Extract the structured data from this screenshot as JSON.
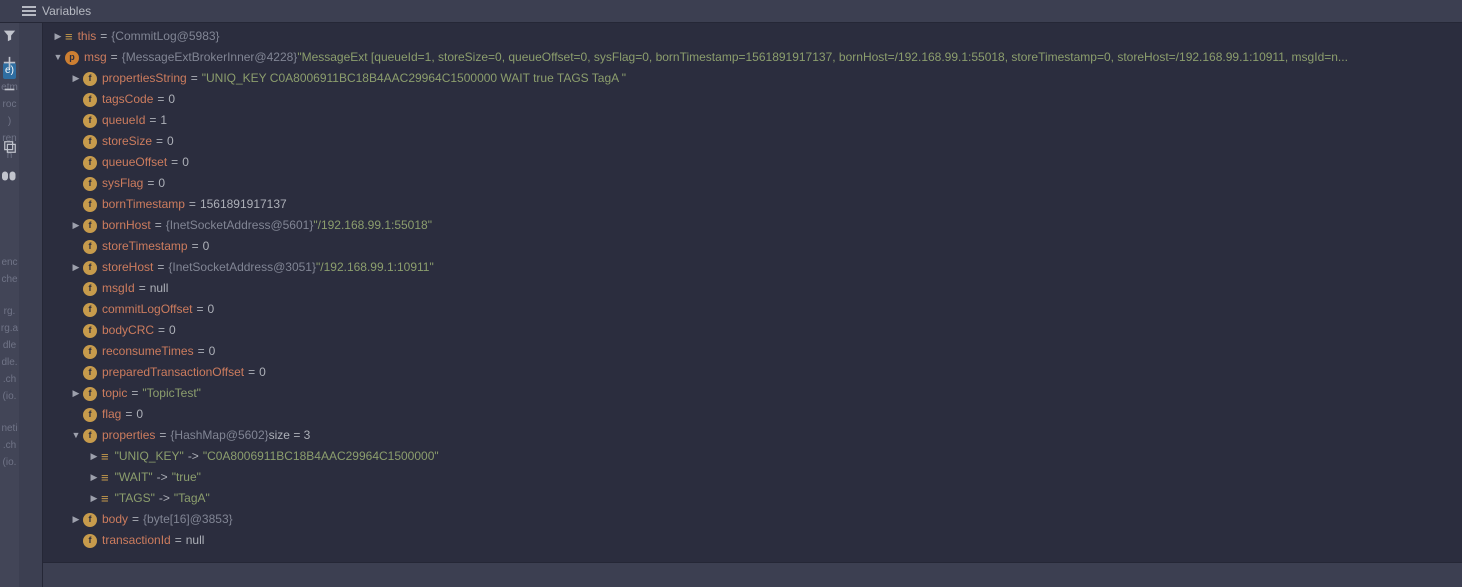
{
  "panel": {
    "title": "Variables"
  },
  "left_truncated_labels": [
    "e)",
    "etm",
    "rock",
    ")",
    "ren",
    "h",
    "",
    "",
    "",
    "",
    "",
    "enc",
    "che",
    "",
    "erg.",
    "rg.a",
    "dle",
    "dle.",
    ".ch",
    "(io.",
    "",
    "neti",
    ".ch",
    "(io."
  ],
  "rows": [
    {
      "depth": 0,
      "arrow": "right",
      "badge": "eq",
      "name": "this",
      "gray": "{CommitLog@5983}",
      "after": ""
    },
    {
      "depth": 0,
      "arrow": "down",
      "badge": "p",
      "name": "msg",
      "gray": "{MessageExtBrokerInner@4228}",
      "str": "\"MessageExt [queueId=1, storeSize=0, queueOffset=0, sysFlag=0, bornTimestamp=1561891917137, bornHost=/192.168.99.1:55018, storeTimestamp=0, storeHost=/192.168.99.1:10911, msgId=n..."
    },
    {
      "depth": 1,
      "arrow": "right",
      "badge": "f",
      "name": "propertiesString",
      "str": "\"UNIQ_KEY C0A8006911BC18B4AAC29964C1500000 WAIT true TAGS TagA \""
    },
    {
      "depth": 1,
      "arrow": "blank",
      "badge": "f",
      "name": "tagsCode",
      "num": "0"
    },
    {
      "depth": 1,
      "arrow": "blank",
      "badge": "f",
      "name": "queueId",
      "num": "1"
    },
    {
      "depth": 1,
      "arrow": "blank",
      "badge": "f",
      "name": "storeSize",
      "num": "0"
    },
    {
      "depth": 1,
      "arrow": "blank",
      "badge": "f",
      "name": "queueOffset",
      "num": "0"
    },
    {
      "depth": 1,
      "arrow": "blank",
      "badge": "f",
      "name": "sysFlag",
      "num": "0"
    },
    {
      "depth": 1,
      "arrow": "blank",
      "badge": "f",
      "name": "bornTimestamp",
      "num": "1561891917137"
    },
    {
      "depth": 1,
      "arrow": "right",
      "badge": "f",
      "name": "bornHost",
      "gray": "{InetSocketAddress@5601}",
      "str": "\"/192.168.99.1:55018\""
    },
    {
      "depth": 1,
      "arrow": "blank",
      "badge": "f",
      "name": "storeTimestamp",
      "num": "0"
    },
    {
      "depth": 1,
      "arrow": "right",
      "badge": "f",
      "name": "storeHost",
      "gray": "{InetSocketAddress@3051}",
      "str": "\"/192.168.99.1:10911\""
    },
    {
      "depth": 1,
      "arrow": "blank",
      "badge": "f",
      "name": "msgId",
      "null": "null"
    },
    {
      "depth": 1,
      "arrow": "blank",
      "badge": "f",
      "name": "commitLogOffset",
      "num": "0"
    },
    {
      "depth": 1,
      "arrow": "blank",
      "badge": "f",
      "name": "bodyCRC",
      "num": "0"
    },
    {
      "depth": 1,
      "arrow": "blank",
      "badge": "f",
      "name": "reconsumeTimes",
      "num": "0"
    },
    {
      "depth": 1,
      "arrow": "blank",
      "badge": "f",
      "name": "preparedTransactionOffset",
      "num": "0"
    },
    {
      "depth": 1,
      "arrow": "right",
      "badge": "f",
      "name": "topic",
      "str": "\"TopicTest\""
    },
    {
      "depth": 1,
      "arrow": "blank",
      "badge": "f",
      "name": "flag",
      "num": "0"
    },
    {
      "depth": 1,
      "arrow": "down",
      "badge": "f",
      "name": "properties",
      "gray": "{HashMap@5602}",
      "aftergray": " size = 3"
    },
    {
      "depth": 2,
      "arrow": "right",
      "badge": "kv",
      "mapk": "\"UNIQ_KEY\"",
      "mapv": "\"C0A8006911BC18B4AAC29964C1500000\""
    },
    {
      "depth": 2,
      "arrow": "right",
      "badge": "kv",
      "mapk": "\"WAIT\"",
      "mapv": "\"true\""
    },
    {
      "depth": 2,
      "arrow": "right",
      "badge": "kv",
      "mapk": "\"TAGS\"",
      "mapv": "\"TagA\""
    },
    {
      "depth": 1,
      "arrow": "right",
      "badge": "f",
      "name": "body",
      "gray": "{byte[16]@3853}"
    },
    {
      "depth": 1,
      "arrow": "blank",
      "badge": "f",
      "name": "transactionId",
      "null": "null"
    }
  ]
}
